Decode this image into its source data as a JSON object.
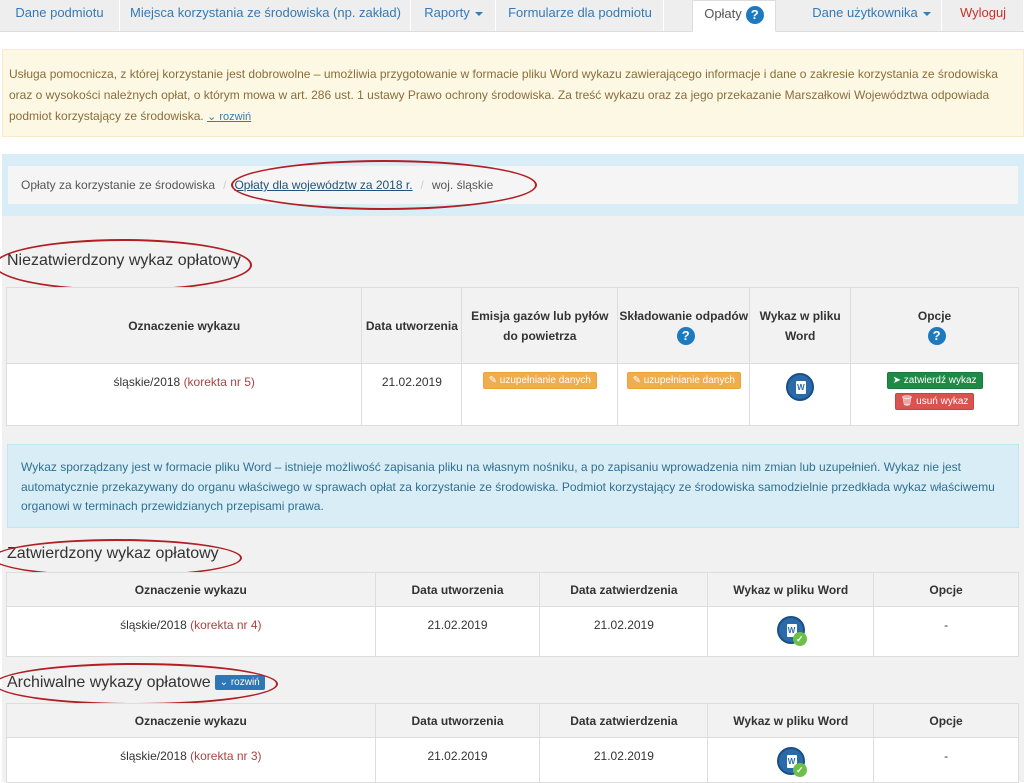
{
  "nav": {
    "tabs": [
      {
        "label": "Dane podmiotu"
      },
      {
        "label": "Miejsca korzystania ze środowiska (np. zakład)"
      },
      {
        "label": "Raporty"
      },
      {
        "label": "Formularze dla podmiotu"
      },
      {
        "label": "Opłaty"
      },
      {
        "label": "Dane użytkownika"
      },
      {
        "label": "Wyloguj"
      }
    ]
  },
  "notice": {
    "text": "Usługa pomocnicza, z której korzystanie jest dobrowolne – umożliwia przygotowanie w formacie pliku Word wykazu zawierającego informacje i dane o zakresie korzystania ze środowiska oraz o wysokości należnych opłat, o którym mowa w art. 286 ust. 1 ustawy Prawo ochrony środowiska. Za treść wykazu oraz za jego przekazanie Marszałkowi Województwa odpowiada podmiot korzystający ze środowiska.",
    "expand": "rozwiń"
  },
  "breadcrumb": {
    "root": "Opłaty za korzystanie ze środowiska",
    "link": "Opłaty dla województw za 2018 r.",
    "current": "woj. śląskie"
  },
  "unapproved": {
    "title": "Niezatwierdzony wykaz opłatowy",
    "headers": [
      "Oznaczenie wykazu",
      "Data utworzenia",
      "Emisja gazów lub pyłów do powietrza",
      "Składowanie odpadów",
      "Wykaz w pliku Word",
      "Opcje"
    ],
    "row": {
      "name": "śląskie/2018",
      "korekta": "(korekta nr 5)",
      "date": "21.02.2019",
      "emisja_btn": "uzupełnianie danych",
      "odpady_btn": "uzupełnianie danych",
      "approve_btn": "zatwierdź wykaz",
      "delete_btn": "usuń wykaz"
    }
  },
  "info": {
    "text": "Wykaz sporządzany jest w formacie pliku Word – istnieje możliwość zapisania pliku na własnym nośniku, a po zapisaniu wprowadzenia nim zmian lub uzupełnień. Wykaz nie jest automatycznie przekazywany do organu właściwego w sprawach opłat za korzystanie ze środowiska. Podmiot korzystający ze środowiska samodzielnie przedkłada wykaz właściwemu organowi w terminach przewidzianych przepisami prawa."
  },
  "approved": {
    "title": "Zatwierdzony wykaz opłatowy",
    "headers": [
      "Oznaczenie wykazu",
      "Data utworzenia",
      "Data zatwierdzenia",
      "Wykaz w pliku Word",
      "Opcje"
    ],
    "row": {
      "name": "śląskie/2018",
      "korekta": "(korekta nr 4)",
      "created": "21.02.2019",
      "approved": "21.02.2019",
      "options": "-"
    }
  },
  "archive": {
    "title": "Archiwalne wykazy opłatowe",
    "expand": "rozwiń",
    "headers": [
      "Oznaczenie wykazu",
      "Data utworzenia",
      "Data zatwierdzenia",
      "Wykaz w pliku Word",
      "Opcje"
    ],
    "row": {
      "name": "śląskie/2018",
      "korekta": "(korekta nr 3)",
      "created": "21.02.2019",
      "approved": "21.02.2019",
      "options": "-"
    }
  },
  "icons": {
    "help": "?",
    "word": "W",
    "check": "✓",
    "pencil": "✎",
    "send": "➤",
    "trash": "🗑",
    "chevron": "⌄"
  }
}
